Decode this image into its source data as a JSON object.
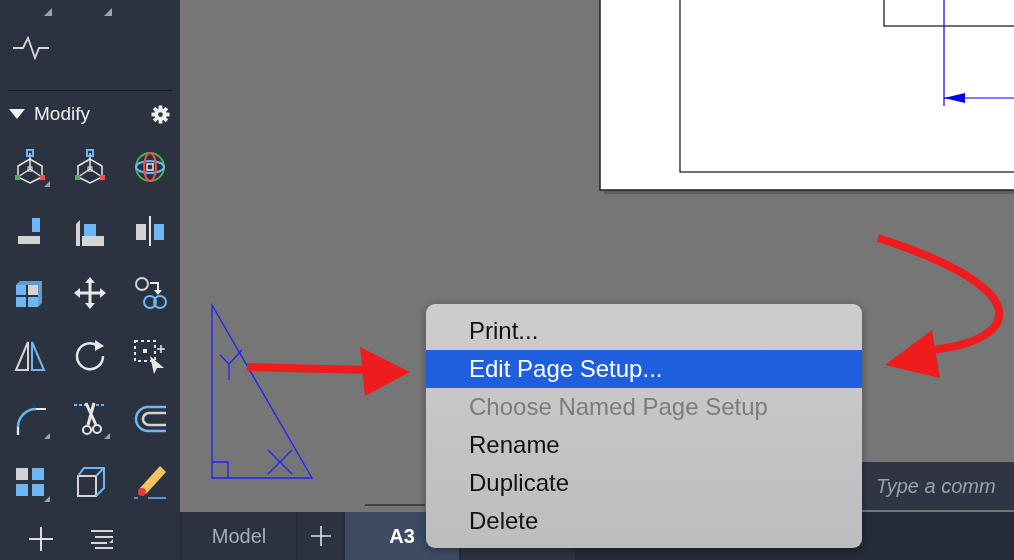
{
  "sidebar": {
    "panel": {
      "title": "Modify",
      "expanded": true
    }
  },
  "command_line": {
    "placeholder": "Type a comm"
  },
  "layout_tabs": [
    {
      "label": "Model",
      "selected": false
    },
    {
      "label": "A3",
      "selected": true
    }
  ],
  "context_menu": {
    "items": [
      {
        "label": "Print...",
        "highlighted": false,
        "disabled": false
      },
      {
        "label": "Edit Page Setup...",
        "highlighted": true,
        "disabled": false
      },
      {
        "label": "Choose Named Page Setup",
        "highlighted": false,
        "disabled": true
      },
      {
        "label": "Rename",
        "highlighted": false,
        "disabled": false
      },
      {
        "label": "Duplicate",
        "highlighted": false,
        "disabled": false
      },
      {
        "label": "Delete",
        "highlighted": false,
        "disabled": false
      }
    ]
  }
}
